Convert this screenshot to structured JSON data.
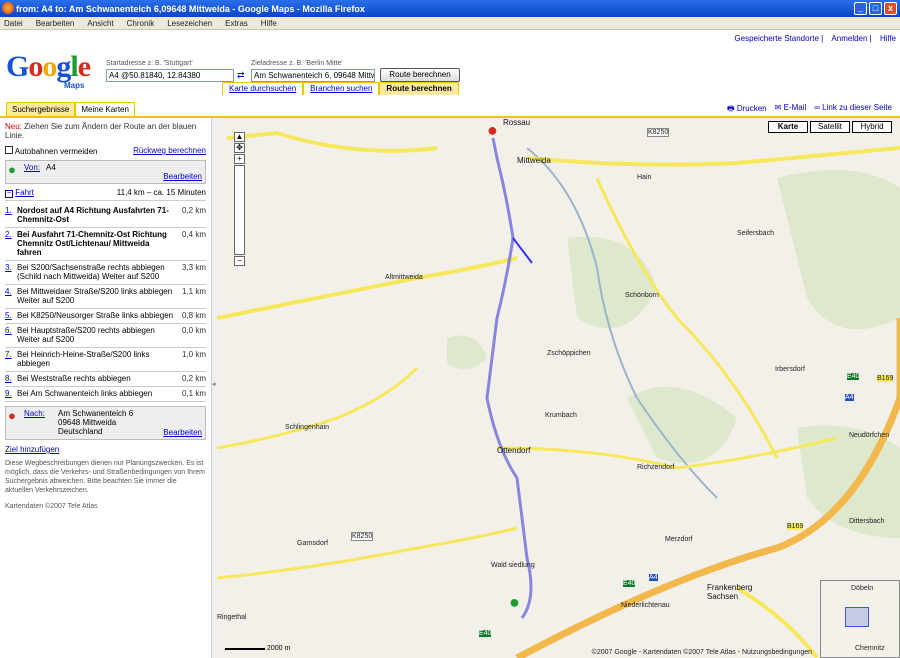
{
  "window": {
    "title": "from: A4 to: Am Schwanenteich 6,09648 Mittweida - Google Maps - Mozilla Firefox",
    "buttons": [
      "_",
      "□",
      "x"
    ]
  },
  "menu": [
    "Datei",
    "Bearbeiten",
    "Ansicht",
    "Chronik",
    "Lesezeichen",
    "Extras",
    "Hilfe"
  ],
  "toplinks": [
    "Gespeicherte Standorte",
    "Anmelden",
    "Hilfe"
  ],
  "logo": {
    "sub": "Maps"
  },
  "form": {
    "start_label": "Startadresse z. B. 'Stuttgart'",
    "start_value": "A4 @50.81840, 12.84380",
    "dest_label": "Zieladresse z. B. 'Berlin Mitte'",
    "dest_value": "Am Schwanenteich 6, 09648 Mittw",
    "submit": "Route berechnen",
    "swap": "⇄"
  },
  "maintabs": [
    "Karte durchsuchen",
    "Branchen suchen",
    "Route berechnen"
  ],
  "lefttabs": [
    "Suchergebnisse",
    "Meine Karten"
  ],
  "actions": [
    "Drucken",
    "E-Mail",
    "Link zu dieser Seite"
  ],
  "panel": {
    "notice_new": "Neu:",
    "notice": " Ziehen Sie zum Ändern der Route an der blauen Linie.",
    "avoid": "Autobahnen vermeiden",
    "return": "Rückweg berechnen",
    "start": {
      "link": "Von:",
      "text": "A4",
      "edit": "Bearbeiten"
    },
    "drive": {
      "label": "Fahrt",
      "summary": "11,4 km – ca. 15 Minuten"
    },
    "steps": [
      {
        "n": "1.",
        "text": "Nordost auf A4 Richtung Ausfahrten 71-Chemnitz-Ost",
        "d": "0,2 km"
      },
      {
        "n": "2.",
        "text": "Bei Ausfahrt 71-Chemnitz-Ost Richtung Chemnitz Ost/Lichtenau/ Mittweida fahren",
        "d": "0,4 km"
      },
      {
        "n": "3.",
        "text": "Bei S200/Sachsenstraße rechts abbiegen (Schild nach Mittweida) Weiter auf S200",
        "d": "3,3 km"
      },
      {
        "n": "4.",
        "text": "Bei Mittweidaer Straße/S200 links abbiegen Weiter auf S200",
        "d": "1,1 km"
      },
      {
        "n": "5.",
        "text": "Bei K8250/Neusorger Straße links abbiegen",
        "d": "0,8 km"
      },
      {
        "n": "6.",
        "text": "Bei Hauptstraße/S200 rechts abbiegen Weiter auf S200",
        "d": "0,0 km"
      },
      {
        "n": "7.",
        "text": "Bei Heinrich-Heine-Straße/S200 links abbiegen",
        "d": "1,0 km"
      },
      {
        "n": "8.",
        "text": "Bei Weststraße rechts abbiegen",
        "d": "0,2 km"
      },
      {
        "n": "9.",
        "text": "Bei Am Schwanenteich links abbiegen",
        "d": "0,1 km"
      }
    ],
    "end": {
      "link": "Nach:",
      "text": "Am Schwanenteich 6 09648 Mittweida Deutschland",
      "edit": "Bearbeiten"
    },
    "add": "Ziel hinzufügen",
    "disclaimer": "Diese Wegbeschreibungen dienen nur Planungszwecken. Es ist möglich, dass die Verkehrs- und Straßenbedingungen von Ihrem Suchergebnis abweichen. Bitte beachten Sie immer die aktuellen Verkehrszeichen.",
    "data": "Kartendaten ©2007 Tele Atlas"
  },
  "map": {
    "types": [
      "Karte",
      "Satellit",
      "Hybrid"
    ],
    "labels": {
      "t1": "Rossau",
      "t2": "Mittweida",
      "t3": "Hain",
      "t4": "Altmittweida",
      "t5": "Schönborn",
      "t6": "Zschöppichen",
      "t7": "Irbersdorf",
      "t8": "Krumbach",
      "t9": "Ottendorf",
      "t10": "Richzendorf",
      "t11": "Merzdorf",
      "t12": "Garnsdorf",
      "t13": "Wald siedlung",
      "t14": "Niederlichtenau",
      "t15": "Frankenberg Sachsen",
      "t16": "Neudörfchen",
      "t17": "Dittersbach",
      "t18": "Seifersbach",
      "t19": "Ringethal",
      "t20": "Schlingenhain",
      "r1": "K8250",
      "r2": "E40",
      "r3": "A4",
      "r4": "B169",
      "r5": "K8250",
      "r6": "E40",
      "r7": "B169",
      "r8": "E40",
      "r9": "A4"
    },
    "scale": "2000 m",
    "copyright": "©2007 Google - Kartendaten ©2007 Tele Atlas - Nutzungsbedingungen",
    "overview": {
      "t1": "Döbeln",
      "t2": "Chemnitz"
    }
  }
}
